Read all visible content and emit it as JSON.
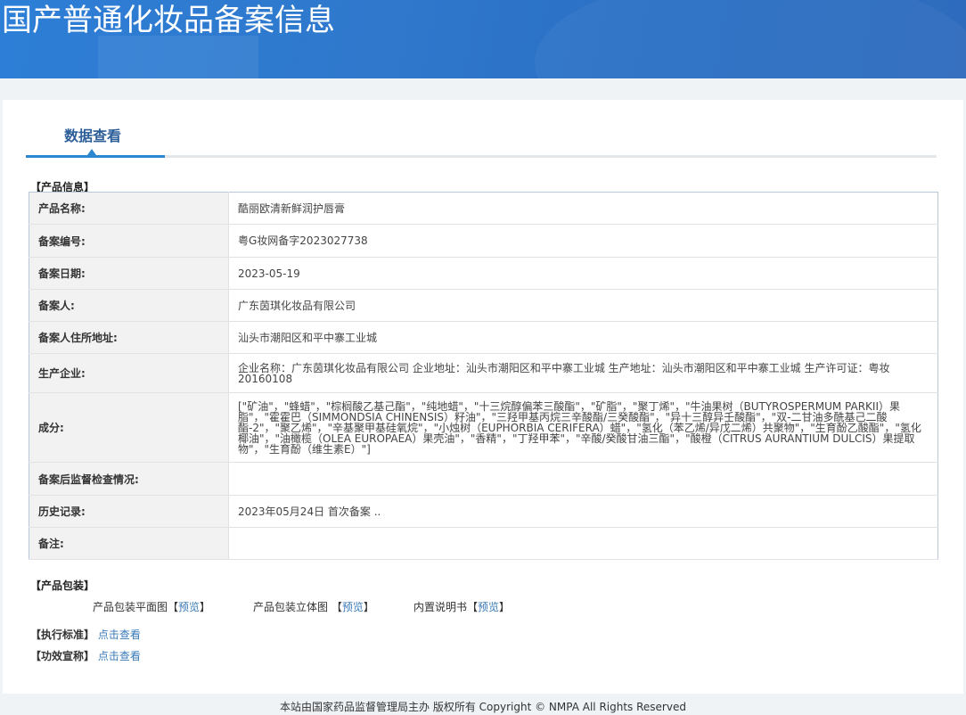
{
  "header": {
    "title": "国产普通化妆品备案信息"
  },
  "tab": {
    "label": "数据查看"
  },
  "product_info": {
    "section": "【产品信息】",
    "rows": [
      {
        "label": "产品名称:",
        "value": "酷丽欧清新鲜润护唇膏"
      },
      {
        "label": "备案编号:",
        "value": "粤G妆网备字2023027738"
      },
      {
        "label": "备案日期:",
        "value": "2023-05-19"
      },
      {
        "label": "备案人:",
        "value": "广东茵琪化妆品有限公司"
      },
      {
        "label": "备案人住所地址:",
        "value": "汕头市潮阳区和平中寨工业城"
      },
      {
        "label": "生产企业:",
        "value": "企业名称：广东茵琪化妆品有限公司 企业地址：汕头市潮阳区和平中寨工业城 生产地址：汕头市潮阳区和平中寨工业城 生产许可证：粤妆20160108"
      },
      {
        "label": "成分:",
        "value": "[\"矿油\"，\"蜂蜡\"，\"棕榈酸乙基己酯\"，\"纯地蜡\"，\"十三烷醇偏苯三酸酯\"，\"矿脂\"，\"聚丁烯\"，\"牛油果树（BUTYROSPERMUM PARKII）果脂\"，\"霍霍巴（SIMMONDSIA CHINENSIS）籽油\"，\"三羟甲基丙烷三辛酸酯/三癸酸酯\"，\"异十三醇异壬酸酯\"，\"双-二甘油多酰基己二酸酯-2\"，\"聚乙烯\"，\"辛基聚甲基硅氧烷\"，\"小烛树（EUPHORBIA CERIFERA）蜡\"，\"氢化（苯乙烯/异戊二烯）共聚物\"，\"生育酚乙酸酯\"，\"氢化椰油\"，\"油橄榄（OLEA EUROPAEA）果壳油\"，\"香精\"，\"丁羟甲苯\"，\"辛酸/癸酸甘油三酯\"，\"酸橙（CITRUS AURANTIUM DULCIS）果提取物\"，\"生育酚（维生素E）\"]"
      },
      {
        "label": "备案后监督检查情况:",
        "value": ""
      },
      {
        "label": "历史记录:",
        "value": "2023年05月24日 首次备案 .."
      },
      {
        "label": "备注:",
        "value": ""
      }
    ]
  },
  "packaging": {
    "section": "【产品包装】",
    "items": [
      {
        "label": "产品包装平面图【",
        "link": "预览",
        "close": "】"
      },
      {
        "label": "产品包装立体图 【",
        "link": "预览",
        "close": "】"
      },
      {
        "label": "内置说明书【",
        "link": "预览",
        "close": "】"
      }
    ]
  },
  "standard": {
    "label": "【执行标准】",
    "link": "点击查看"
  },
  "efficacy": {
    "label": "【功效宣称】",
    "link": "点击查看"
  },
  "footer": {
    "text": "本站由国家药品监督管理局主办 版权所有 Copyright © NMPA All Rights Reserved"
  }
}
